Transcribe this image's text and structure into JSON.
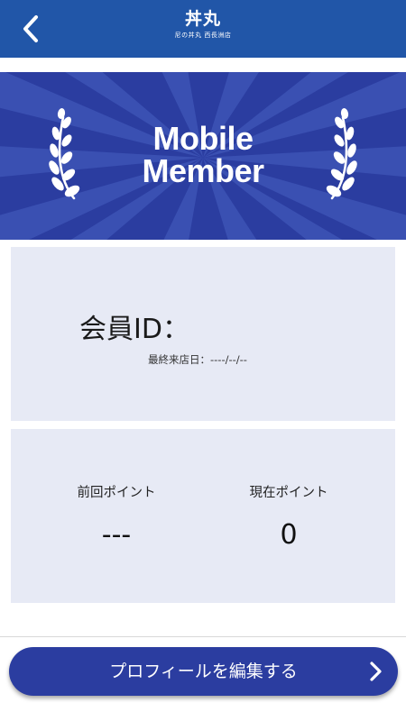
{
  "header": {
    "logo_main": "丼丸",
    "logo_sub": "尼の丼丸 西長洲店",
    "back_icon": "chevron-left-icon",
    "background": "#2156a8"
  },
  "banner": {
    "title_line1": "Mobile",
    "title_line2": "Member",
    "background": "#2b3da0",
    "decoration_icon": "laurel-icon"
  },
  "member": {
    "label": "会員ID：",
    "id_value": "",
    "last_visit": "最終来店日：----/--/--"
  },
  "points": {
    "previous_label": "前回ポイント",
    "previous_value": "---",
    "current_label": "現在ポイント",
    "current_value": "0"
  },
  "footer": {
    "edit_button_label": "プロフィールを編集する",
    "edit_icon": "chevron-right-icon",
    "button_color": "#2b3da0"
  }
}
